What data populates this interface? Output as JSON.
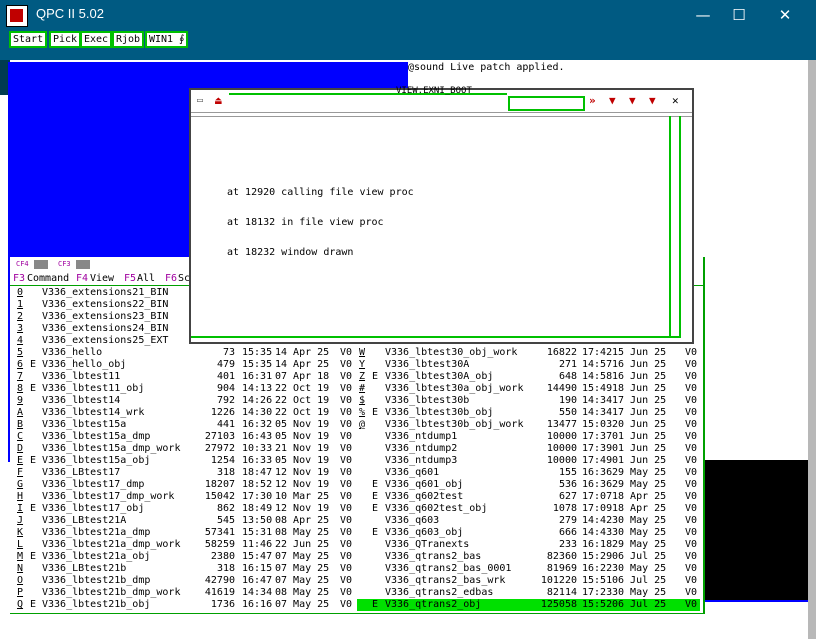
{
  "window": {
    "title": "QPC II 5.02",
    "minimize": "—",
    "maximize": "☐",
    "close": "✕"
  },
  "toolbar": [
    "Start",
    "Pick",
    "Exec",
    "Rjob",
    "WIN1 ∮"
  ],
  "status_message": "@sound Live patch applied.",
  "dialog": {
    "name": "VIEW.EXNI_BOOT",
    "lines": [
      "at 12920 calling file view proc",
      "at 18132 in file view proc",
      "at 18232 window drawn"
    ],
    "icons": [
      "»",
      "▼",
      "▼",
      "▼",
      "✕"
    ]
  },
  "file_manager": {
    "top_icons": [
      "CF4",
      "CF3"
    ],
    "function_keys": [
      {
        "key": "F3",
        "label": "Command"
      },
      {
        "key": "F4",
        "label": "View"
      },
      {
        "key": "F5",
        "label": "All"
      },
      {
        "key": "F6",
        "label": "Sc"
      }
    ],
    "left": [
      {
        "k": "0",
        "f": "",
        "n": "V336_extensions21_BIN",
        "s": "",
        "t": "",
        "d": "",
        "v": ""
      },
      {
        "k": "1",
        "f": "",
        "n": "V336_extensions22_BIN",
        "s": "",
        "t": "",
        "d": "",
        "v": ""
      },
      {
        "k": "2",
        "f": "",
        "n": "V336_extensions23_BIN",
        "s": "",
        "t": "",
        "d": "",
        "v": ""
      },
      {
        "k": "3",
        "f": "",
        "n": "V336_extensions24_BIN",
        "s": "",
        "t": "",
        "d": "",
        "v": ""
      },
      {
        "k": "4",
        "f": "",
        "n": "V336_extensions25_EXT",
        "s": "",
        "t": "",
        "d": "",
        "v": ""
      },
      {
        "k": "5",
        "f": "",
        "n": "V336_hello",
        "s": "73",
        "t": "15:35",
        "d": "14 Apr 25",
        "v": "V0"
      },
      {
        "k": "6",
        "f": "E",
        "n": "V336_hello_obj",
        "s": "479",
        "t": "15:35",
        "d": "14 Apr 25",
        "v": "V0"
      },
      {
        "k": "7",
        "f": "",
        "n": "V336_lbtest11",
        "s": "401",
        "t": "16:31",
        "d": "07 Apr 18",
        "v": "V0"
      },
      {
        "k": "8",
        "f": "E",
        "n": "V336_lbtest11_obj",
        "s": "904",
        "t": "14:13",
        "d": "22 Oct 19",
        "v": "V0"
      },
      {
        "k": "9",
        "f": "",
        "n": "V336_lbtest14",
        "s": "792",
        "t": "14:26",
        "d": "22 Oct 19",
        "v": "V0"
      },
      {
        "k": "A",
        "f": "",
        "n": "V336_lbtest14_wrk",
        "s": "1226",
        "t": "14:30",
        "d": "22 Oct 19",
        "v": "V0"
      },
      {
        "k": "B",
        "f": "",
        "n": "V336_lbtest15a",
        "s": "441",
        "t": "16:32",
        "d": "05 Nov 19",
        "v": "V0"
      },
      {
        "k": "C",
        "f": "",
        "n": "V336_lbtest15a_dmp",
        "s": "27103",
        "t": "16:43",
        "d": "05 Nov 19",
        "v": "V0"
      },
      {
        "k": "D",
        "f": "",
        "n": "V336_lbtest15a_dmp_work",
        "s": "27972",
        "t": "10:33",
        "d": "21 Nov 19",
        "v": "V0"
      },
      {
        "k": "E",
        "f": "E",
        "n": "V336_lbtest15a_obj",
        "s": "1254",
        "t": "16:33",
        "d": "05 Nov 19",
        "v": "V0"
      },
      {
        "k": "F",
        "f": "",
        "n": "V336_LBtest17",
        "s": "318",
        "t": "18:47",
        "d": "12 Nov 19",
        "v": "V0"
      },
      {
        "k": "G",
        "f": "",
        "n": "V336_lbtest17_dmp",
        "s": "18207",
        "t": "18:52",
        "d": "12 Nov 19",
        "v": "V0"
      },
      {
        "k": "H",
        "f": "",
        "n": "V336_lbtest17_dmp_work",
        "s": "15042",
        "t": "17:30",
        "d": "10 Mar 25",
        "v": "V0"
      },
      {
        "k": "I",
        "f": "E",
        "n": "V336_lbtest17_obj",
        "s": "862",
        "t": "18:49",
        "d": "12 Nov 19",
        "v": "V0"
      },
      {
        "k": "J",
        "f": "",
        "n": "V336_LBtest21A",
        "s": "545",
        "t": "13:50",
        "d": "08 Apr 25",
        "v": "V0"
      },
      {
        "k": "K",
        "f": "",
        "n": "V336_lbtest21a_dmp",
        "s": "57341",
        "t": "15:31",
        "d": "08 May 25",
        "v": "V0"
      },
      {
        "k": "L",
        "f": "",
        "n": "V336_lbtest21a_dmp_work",
        "s": "58259",
        "t": "11:46",
        "d": "22 Jun 25",
        "v": "V0"
      },
      {
        "k": "M",
        "f": "E",
        "n": "V336_lbtest21a_obj",
        "s": "2380",
        "t": "15:47",
        "d": "07 May 25",
        "v": "V0"
      },
      {
        "k": "N",
        "f": "",
        "n": "V336_LBtest21b",
        "s": "318",
        "t": "16:15",
        "d": "07 May 25",
        "v": "V0"
      },
      {
        "k": "O",
        "f": "",
        "n": "V336_lbtest21b_dmp",
        "s": "42790",
        "t": "16:47",
        "d": "07 May 25",
        "v": "V0"
      },
      {
        "k": "P",
        "f": "",
        "n": "V336_lbtest21b_dmp_work",
        "s": "41619",
        "t": "14:34",
        "d": "08 May 25",
        "v": "V0"
      },
      {
        "k": "Q",
        "f": "E",
        "n": "V336_lbtest21b_obj",
        "s": "1736",
        "t": "16:16",
        "d": "07 May 25",
        "v": "V0"
      }
    ],
    "right": [
      {
        "k": "W",
        "f": "",
        "n": "V336_lbtest30_obj_work",
        "s": "16822",
        "t": "17:42",
        "d": "15 Jun 25",
        "v": "V0"
      },
      {
        "k": "Y",
        "f": "",
        "n": "V336_lbtest30A",
        "s": "271",
        "t": "14:57",
        "d": "16 Jun 25",
        "v": "V0"
      },
      {
        "k": "Z",
        "f": "E",
        "n": "V336_lbtest30A_obj",
        "s": "648",
        "t": "14:58",
        "d": "16 Jun 25",
        "v": "V0"
      },
      {
        "k": "#",
        "f": "",
        "n": "V336_lbtest30a_obj_work",
        "s": "14490",
        "t": "15:49",
        "d": "18 Jun 25",
        "v": "V0"
      },
      {
        "k": "$",
        "f": "",
        "n": "V336_lbtest30b",
        "s": "190",
        "t": "14:34",
        "d": "17 Jun 25",
        "v": "V0"
      },
      {
        "k": "%",
        "f": "E",
        "n": "V336_lbtest30b_obj",
        "s": "550",
        "t": "14:34",
        "d": "17 Jun 25",
        "v": "V0"
      },
      {
        "k": "@",
        "f": "",
        "n": "V336_lbtest30b_obj_work",
        "s": "13477",
        "t": "15:03",
        "d": "20 Jun 25",
        "v": "V0"
      },
      {
        "k": "",
        "f": "",
        "n": "V336_ntdump1",
        "s": "10000",
        "t": "17:37",
        "d": "01 Jun 25",
        "v": "V0"
      },
      {
        "k": "",
        "f": "",
        "n": "V336_ntdump2",
        "s": "10000",
        "t": "17:39",
        "d": "01 Jun 25",
        "v": "V0"
      },
      {
        "k": "",
        "f": "",
        "n": "V336_ntdump3",
        "s": "10000",
        "t": "17:49",
        "d": "01 Jun 25",
        "v": "V0"
      },
      {
        "k": "",
        "f": "",
        "n": "V336_q601",
        "s": "155",
        "t": "16:36",
        "d": "29 May 25",
        "v": "V0"
      },
      {
        "k": "",
        "f": "E",
        "n": "V336_q601_obj",
        "s": "536",
        "t": "16:36",
        "d": "29 May 25",
        "v": "V0"
      },
      {
        "k": "",
        "f": "E",
        "n": "V336_q602test",
        "s": "627",
        "t": "17:07",
        "d": "18 Apr 25",
        "v": "V0"
      },
      {
        "k": "",
        "f": "E",
        "n": "V336_q602test_obj",
        "s": "1078",
        "t": "17:09",
        "d": "18 Apr 25",
        "v": "V0"
      },
      {
        "k": "",
        "f": "",
        "n": "V336_q603",
        "s": "279",
        "t": "14:42",
        "d": "30 May 25",
        "v": "V0"
      },
      {
        "k": "",
        "f": "E",
        "n": "V336_q603_obj",
        "s": "666",
        "t": "14:43",
        "d": "30 May 25",
        "v": "V0"
      },
      {
        "k": "",
        "f": "",
        "n": "V336_QTranexts",
        "s": "233",
        "t": "16:18",
        "d": "29 May 25",
        "v": "V0"
      },
      {
        "k": "",
        "f": "",
        "n": "V336_qtrans2_bas",
        "s": "82360",
        "t": "15:29",
        "d": "06 Jul 25",
        "v": "V0"
      },
      {
        "k": "",
        "f": "",
        "n": "V336_qtrans2_bas_0001",
        "s": "81969",
        "t": "16:22",
        "d": "30 May 25",
        "v": "V0"
      },
      {
        "k": "",
        "f": "",
        "n": "V336_qtrans2_bas_wrk",
        "s": "101220",
        "t": "15:51",
        "d": "06 Jul 25",
        "v": "V0"
      },
      {
        "k": "",
        "f": "",
        "n": "V336_qtrans2_edbas",
        "s": "82114",
        "t": "17:23",
        "d": "30 May 25",
        "v": "V0"
      },
      {
        "k": "",
        "f": "E",
        "n": "V336_qtrans2_obj",
        "s": "125058",
        "t": "15:52",
        "d": "06 Jul 25",
        "v": "V0"
      }
    ]
  },
  "colors": {
    "titlebar": "#005a82",
    "toolbar_border": "#00c000",
    "desktop_blue": "#0000ff",
    "highlight": "#00e000",
    "key_magenta": "#a000a0"
  }
}
